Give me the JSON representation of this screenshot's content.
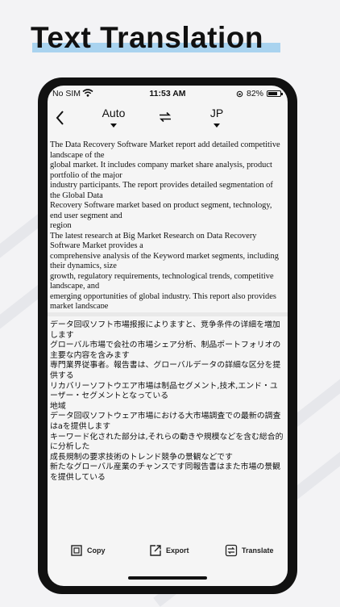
{
  "headline": "Text Translation",
  "status_bar": {
    "carrier": "No SIM",
    "time": "11:53 AM",
    "battery": "82%",
    "battery_level": 0.82
  },
  "nav": {
    "source_lang": "Auto",
    "target_lang": "JP"
  },
  "source_text": "The Data Recovery Software Market report add detailed competitive landscape of the\nglobal market. It includes company market share analysis, product portfolio of the major\nindustry participants. The report provides detailed segmentation of the Global Data\nRecovery Software market based on product segment, technology, end user segment and\nregion\nThe latest research at Big Market Research on Data Recovery Software Market provides a\ncomprehensive analysis of the Keyword market segments, including their dynamics, size\ngrowth, regulatory requirements, technological trends, competitive landscape, and\nemerging opportunities of global industry. This report also provides market landscape",
  "translated_text": "データ回収ソフト市場报报によりますと、竞争条件の详細を増加します\nグローバル市場で会社の市場シェア分析、制品ポートフォリオの主要な内容を含みます\n専門業界従事者。報告書は、グローバルデータの詳細な区分を提供する\nリカバリーソフトウエア市場は制品セグメント,技术,エンド・ユーザー・セグメントとなっている\n地域\nデータ回収ソフトウェア市場における大市場調査での最新の調査はaを提供します\nキーワード化された部分は,それらの動きや規模などを含む総合的に分析した\n成長規制の要求技術のトレンド競争の景観などです\n新たなグローバル産業のチャンスです同報告書はまた市場の景観を提供している",
  "toolbar": {
    "copy": "Copy",
    "export": "Export",
    "translate": "Translate"
  }
}
